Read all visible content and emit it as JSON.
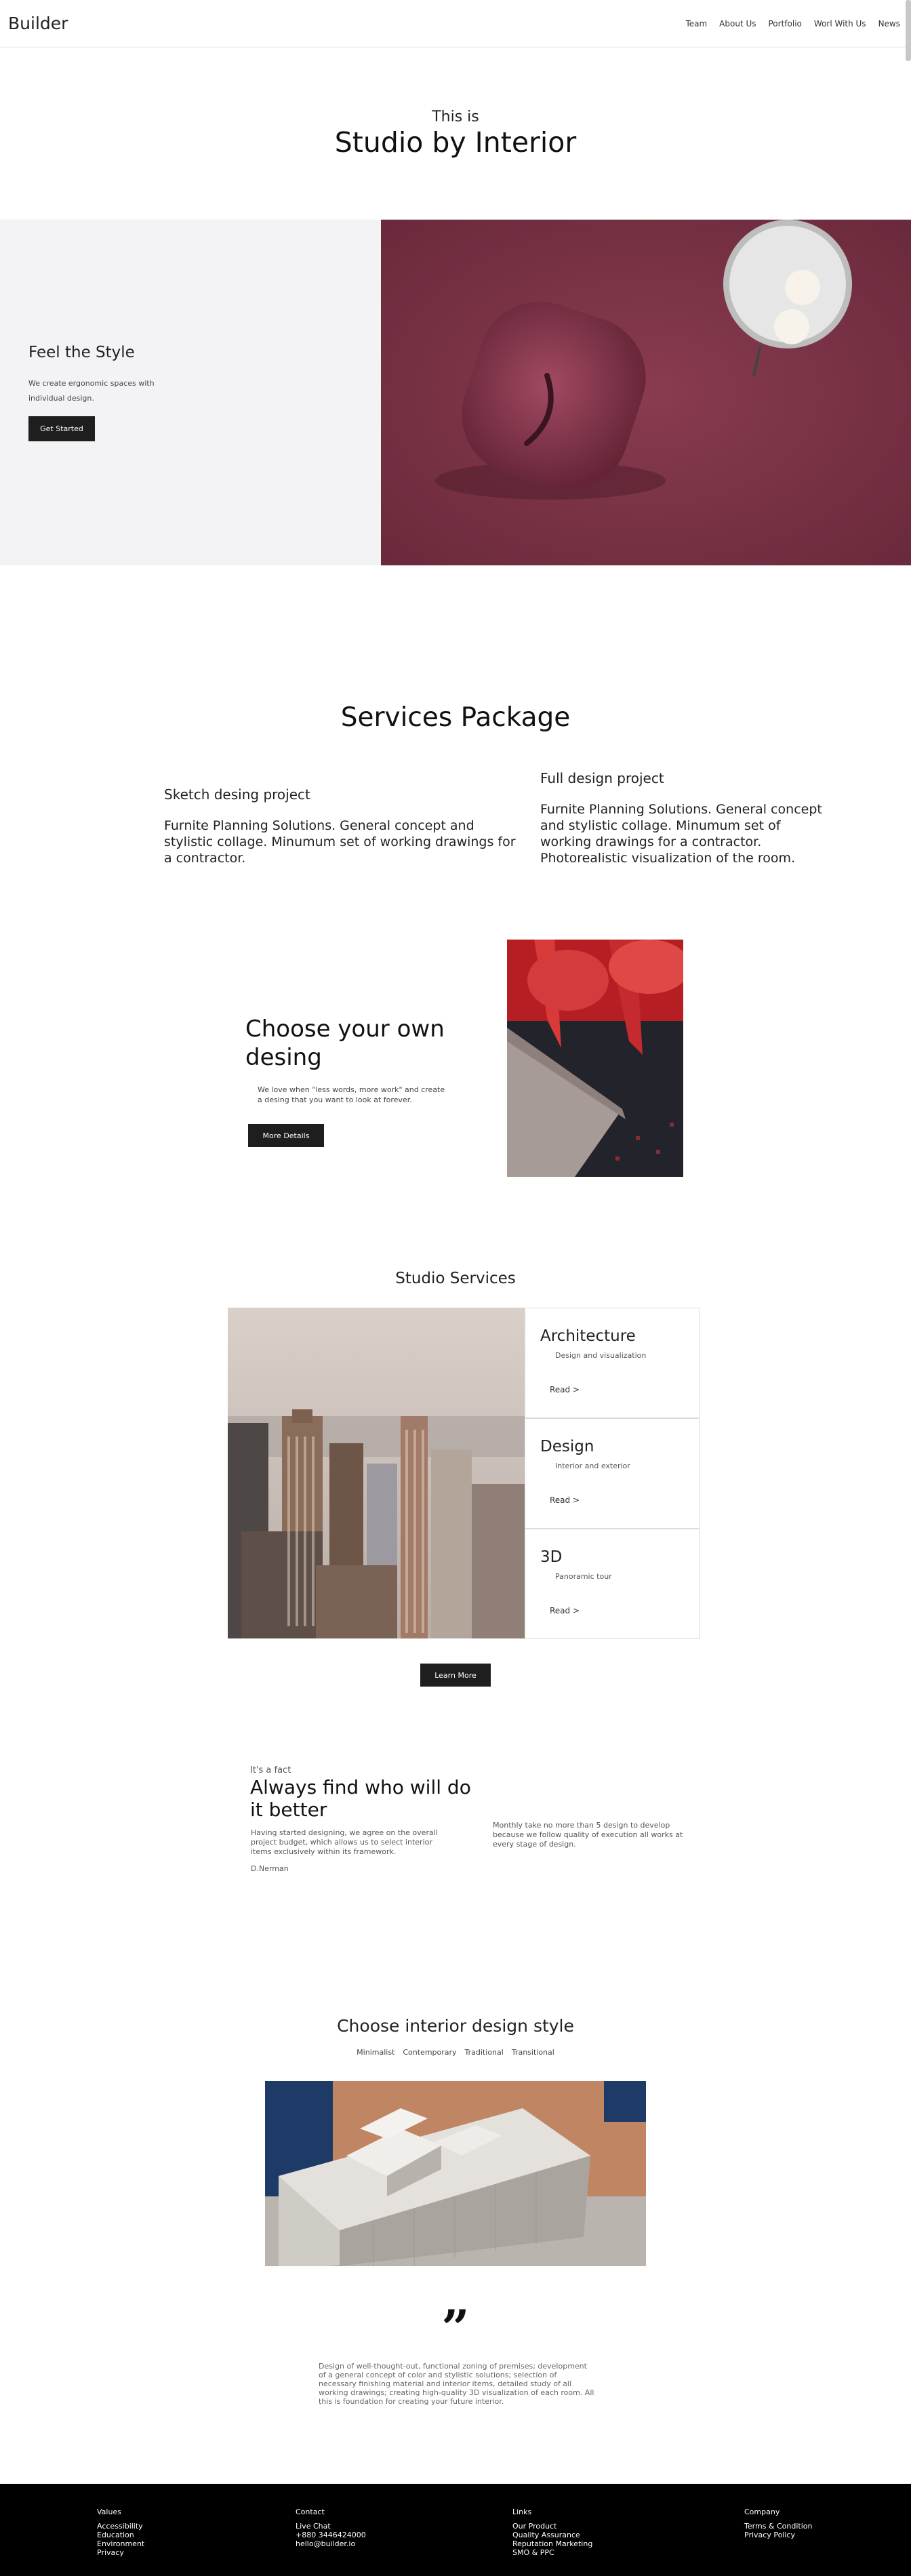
{
  "header": {
    "logo": "Builder",
    "nav": [
      "Team",
      "About Us",
      "Portfolio",
      "Worl With Us",
      "News"
    ]
  },
  "hero": {
    "subtitle": "This is",
    "title": "Studio by Interior"
  },
  "feel": {
    "title": "Feel the Style",
    "text": "We create ergonomic spaces with individual design.",
    "button": "Get Started"
  },
  "services_package": {
    "title": "Services Package",
    "packages": [
      {
        "name": "Sketch desing project",
        "description": "Furnite Planning Solutions. General concept and stylistic collage. Minumum set of working drawings for a contractor."
      },
      {
        "name": "Full design project",
        "description": "Furnite Planning Solutions. General concept and stylistic collage. Minumum set of working drawings for a contractor. Photorealistic visualization of the room."
      }
    ]
  },
  "choose_own": {
    "title": "Choose your own desing",
    "text": "We love when \"less words, more work\" and create a desing that you want to look at forever.",
    "button": "More Details"
  },
  "studio_services": {
    "title": "Studio Services",
    "cards": [
      {
        "title": "Architecture",
        "subtitle": "Design and visualization",
        "link": "Read >"
      },
      {
        "title": "Design",
        "subtitle": "Interior and exterior",
        "link": "Read >"
      },
      {
        "title": "3D",
        "subtitle": "Panoramic tour",
        "link": "Read >"
      }
    ],
    "button": "Learn More"
  },
  "fact": {
    "kicker": "It's a fact",
    "title": "Always find who will do it better",
    "left_text": "Having started designing, we agree on the overall project budget, which allows us to select interior items exclusively within its framework.",
    "author": "D.Nerman",
    "right_text": "Monthly take no more than 5 design to develop because we follow quality of execution all works at every stage of design."
  },
  "style": {
    "title": "Choose interior design style",
    "tabs": [
      "Minimalist",
      "Contemporary",
      "Traditional",
      "Transitional"
    ]
  },
  "quote": {
    "mark": "”",
    "text": "Design of well-thought-out, functional zoning of premises; development of a general concept of color and stylistic solutions; selection of necessary finishing material and interior items, detailed study of all working drawings; creating high-quality 3D visualization of each room. All this is foundation for creating your future interior."
  },
  "footer": {
    "columns": [
      {
        "heading": "Values",
        "links": [
          "Accessibility",
          "Education",
          "Environment",
          "Privacy"
        ]
      },
      {
        "heading": "Contact",
        "links": [
          "Live Chat",
          "+880 3446424000",
          "hello@builder.io"
        ]
      },
      {
        "heading": "Links",
        "links": [
          "Our Product",
          "Quality Assurance",
          "Reputation Marketing",
          "SMO & PPC"
        ]
      },
      {
        "heading": "Company",
        "links": [
          "Terms & Condition",
          "Privacy Policy"
        ]
      }
    ]
  },
  "colors": {
    "hero_image": "#7d3447",
    "dark_button": "#1e1e1e",
    "footer_bg": "#000000",
    "feel_bg": "#f3f3f5"
  }
}
